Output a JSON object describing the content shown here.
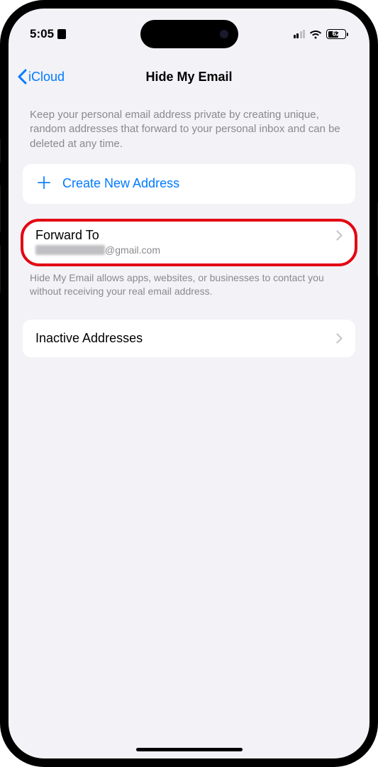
{
  "statusBar": {
    "time": "5:05",
    "batteryPercent": "62"
  },
  "nav": {
    "backLabel": "iCloud",
    "title": "Hide My Email"
  },
  "intro": {
    "text": "Keep your personal email address private by creating unique, random addresses that forward to your personal inbox and can be deleted at any time."
  },
  "createRow": {
    "label": "Create New Address"
  },
  "forwardRow": {
    "title": "Forward To",
    "emailDomain": "@gmail.com",
    "footer": "Hide My Email allows apps, websites, or businesses to contact you without receiving your real email address."
  },
  "inactiveRow": {
    "label": "Inactive Addresses"
  }
}
